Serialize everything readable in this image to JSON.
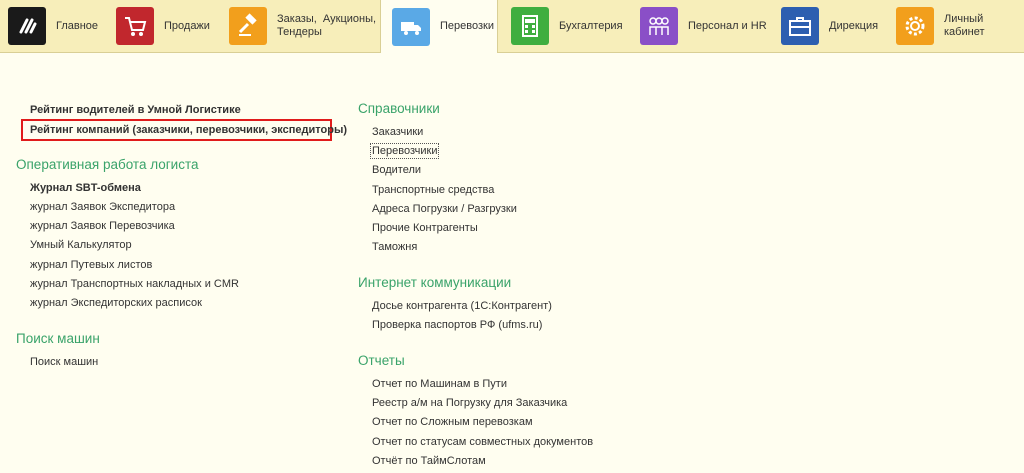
{
  "nav": {
    "tabs": [
      {
        "label": "Главное",
        "icon": "logo-icon",
        "color": "#1a1a1a"
      },
      {
        "label": "Продажи",
        "icon": "cart-icon",
        "color": "#c1272d"
      },
      {
        "label": "Заказы,  Аукционы,\nТендеры",
        "icon": "gavel-icon",
        "color": "#f29f1c"
      },
      {
        "label": "Перевозки",
        "icon": "truck-icon",
        "color": "#5aa9e6",
        "active": true
      },
      {
        "label": "Бухгалтерия",
        "icon": "calculator-icon",
        "color": "#3fae3f"
      },
      {
        "label": "Персонал и HR",
        "icon": "people-icon",
        "color": "#8a4fc7"
      },
      {
        "label": "Дирекция",
        "icon": "briefcase-icon",
        "color": "#2d5fb0"
      },
      {
        "label": "Личный кабинет",
        "icon": "gear-icon",
        "color": "#f29f1c"
      }
    ]
  },
  "left": {
    "top_links": [
      "Рейтинг водителей в Умной Логистике",
      "Рейтинг компаний (заказчики, перевозчики, экспедиторы)"
    ],
    "sections": [
      {
        "title": "Оперативная работа логиста",
        "items": [
          "Журнал SBT-обмена",
          "журнал Заявок Экспедитора",
          "журнал Заявок Перевозчика",
          "Умный Калькулятор",
          "журнал Путевых листов",
          "журнал Транспортных накладных и CMR",
          "журнал Экспедиторских расписок"
        ]
      },
      {
        "title": "Поиск машин",
        "items": [
          "Поиск машин"
        ]
      }
    ]
  },
  "right": {
    "sections": [
      {
        "title": "Справочники",
        "items": [
          "Заказчики",
          "Перевозчики",
          "Водители",
          "Транспортные средства",
          "Адреса Погрузки / Разгрузки",
          "Прочие Контрагенты",
          "Таможня"
        ]
      },
      {
        "title": "Интернет коммуникации",
        "items": [
          "Досье контрагента (1С:Контрагент)",
          "Проверка паспортов РФ (ufms.ru)"
        ]
      },
      {
        "title": "Отчеты",
        "items": [
          "Отчет по Машинам в Пути",
          "Реестр а/м на Погрузку для Заказчика",
          "Отчет по Сложным перевозкам",
          "Отчет по статусам совместных документов",
          "Отчёт по ТаймСлотам"
        ]
      }
    ]
  }
}
